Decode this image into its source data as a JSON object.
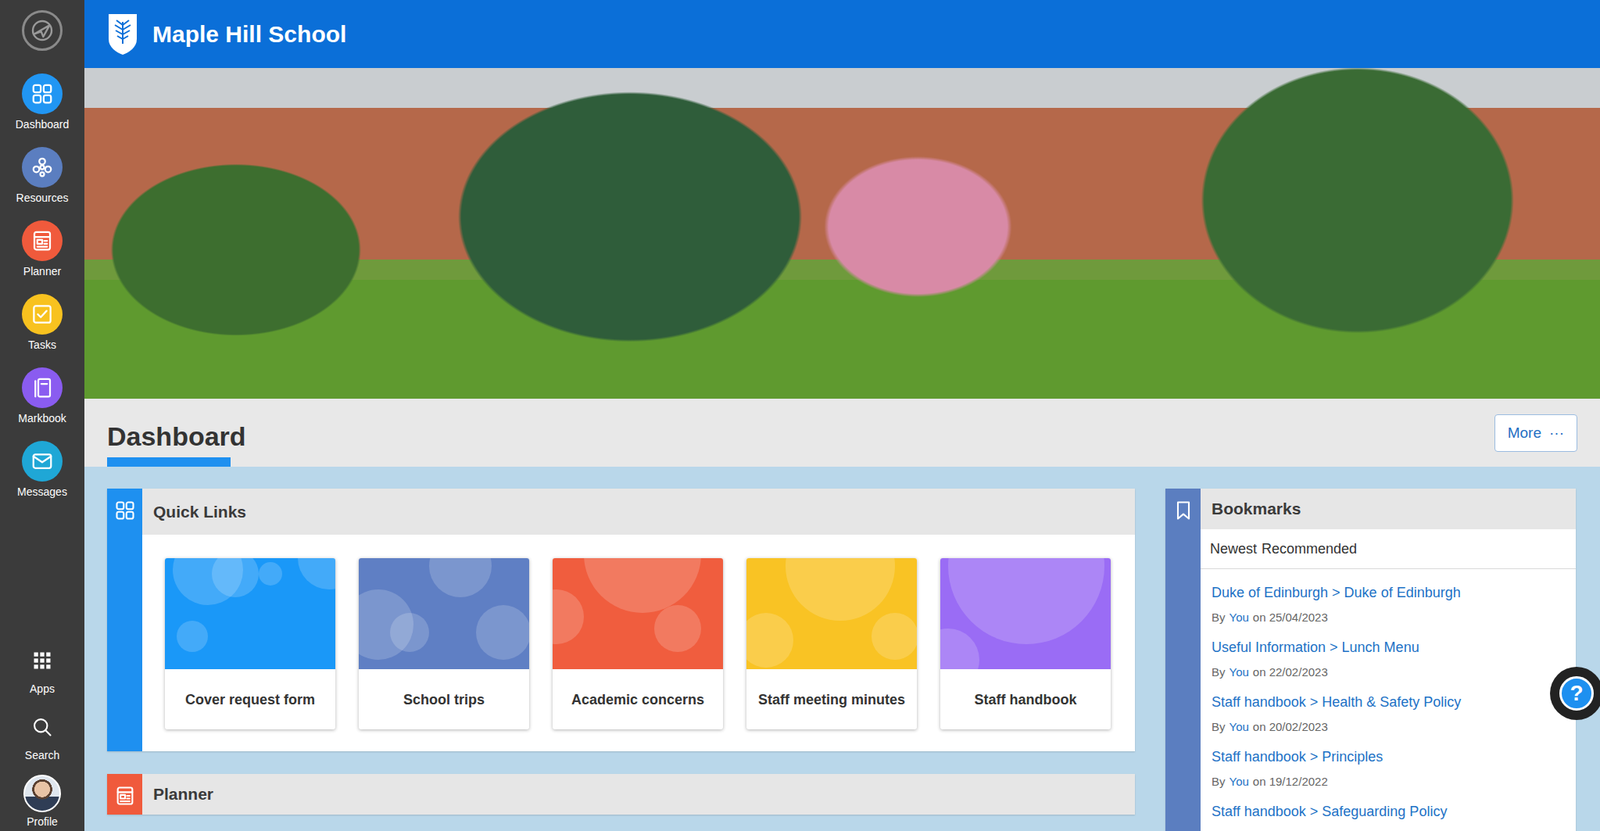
{
  "app": {
    "title": "Maple Hill School"
  },
  "sidebar": {
    "items": [
      {
        "label": "Dashboard",
        "color": "#2196f3",
        "kind": "dashboard"
      },
      {
        "label": "Resources",
        "color": "#5b7ec0",
        "kind": "resources"
      },
      {
        "label": "Planner",
        "color": "#f05a3c",
        "kind": "planner"
      },
      {
        "label": "Tasks",
        "color": "#f8c21f",
        "kind": "tasks"
      },
      {
        "label": "Markbook",
        "color": "#8a5cf0",
        "kind": "markbook"
      },
      {
        "label": "Messages",
        "color": "#1fa7d6",
        "kind": "messages"
      }
    ],
    "bottom": [
      {
        "label": "Apps",
        "kind": "apps"
      },
      {
        "label": "Search",
        "kind": "search"
      },
      {
        "label": "Profile",
        "kind": "profile"
      }
    ]
  },
  "page": {
    "title": "Dashboard",
    "more": {
      "label": "More",
      "icon": "···"
    }
  },
  "quick_links": {
    "title": "Quick Links",
    "cards": [
      {
        "label": "Cover request form",
        "color": "#1a98f8"
      },
      {
        "label": "School trips",
        "color": "#5f7fc4"
      },
      {
        "label": "Academic concerns",
        "color": "#f05d3e"
      },
      {
        "label": "Staff meeting minutes",
        "color": "#f9c324"
      },
      {
        "label": "Staff handbook",
        "color": "#9a6cf5"
      }
    ]
  },
  "bookmarks": {
    "title": "Bookmarks",
    "tabs": [
      {
        "label": "Newest"
      },
      {
        "label": "Recommended"
      }
    ],
    "items": [
      {
        "title": "Duke of Edinburgh > Duke of Edinburgh",
        "by": "By",
        "author": "You",
        "date": "on 25/04/2023"
      },
      {
        "title": "Useful Information > Lunch Menu",
        "by": "By",
        "author": "You",
        "date": "on 22/02/2023"
      },
      {
        "title": "Staff handbook > Health & Safety Policy",
        "by": "By",
        "author": "You",
        "date": "on 20/02/2023"
      },
      {
        "title": "Staff handbook > Principles",
        "by": "By",
        "author": "You",
        "date": "on 19/12/2022"
      },
      {
        "title": "Staff handbook > Safeguarding Policy"
      }
    ]
  },
  "planner": {
    "title": "Planner"
  },
  "help": {
    "label": "?"
  }
}
